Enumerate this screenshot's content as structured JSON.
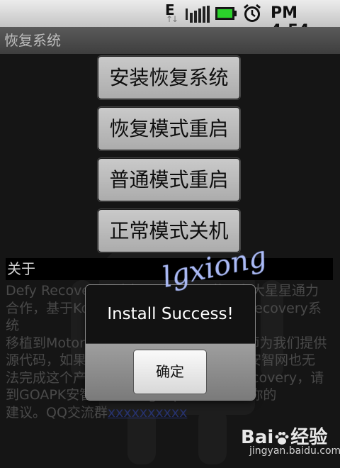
{
  "status_bar": {
    "network": "E",
    "network_arrows": "↑↓",
    "time": "PM 4:54",
    "icons": [
      "signal-icon",
      "battery-icon",
      "alarm-icon"
    ]
  },
  "app": {
    "title": "恢复系统"
  },
  "buttons": {
    "install": "安装恢复系统",
    "reboot_recovery": "恢复模式重启",
    "reboot_normal": "普通模式重启",
    "shutdown": "正常模式关机"
  },
  "about": {
    "header": "关于",
    "text_lines": [
      "Defy Recovery是安智网与大师、黄司和大星星通力",
      "合作，基于Koush的Droid X bootstrapRecovery系统",
      "移植到Motorola defy上的，非常感谢大师为我们提供",
      "源代码，如果你的手机使用了本软件后在安智网也无",
      "法完成这个产品的安装，请使用官方的Recovery，请",
      "到GOAPK安智论坛bbs.goapk.com反馈你的",
      "建议。QQ交流群"
    ],
    "link_text": "xxxxxxxxxx"
  },
  "dialog": {
    "message": "Install Success!",
    "ok_label": "确定"
  },
  "watermarks": {
    "lgxiong": "lgxiong",
    "baidu": "Bai",
    "baidu_cn": "经验",
    "baidu_url": "jingyan.baidu.com"
  },
  "colors": {
    "background": "#1a1a1a",
    "dialog_bg": "#121212",
    "about_header_bg": "#000000",
    "about_text": "#5a5a5a"
  }
}
